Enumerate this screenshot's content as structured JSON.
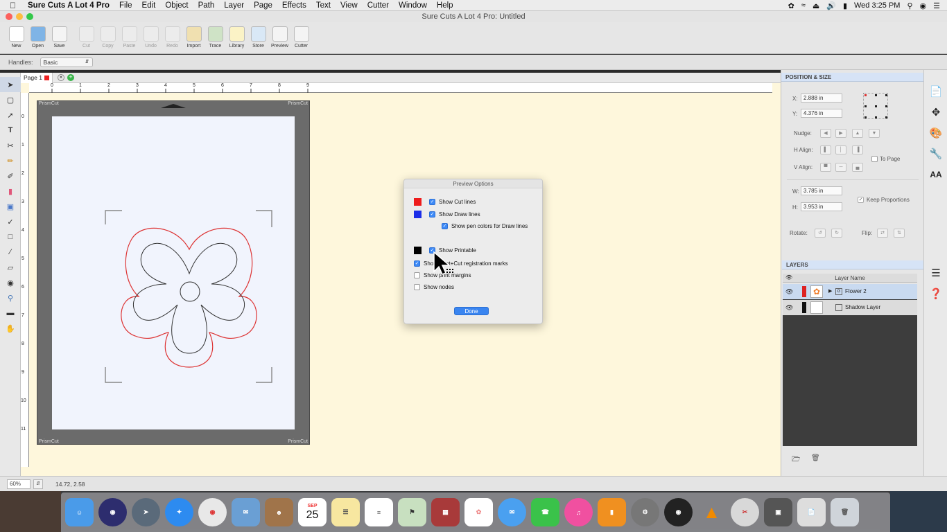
{
  "menubar": {
    "app_name": "Sure Cuts A Lot 4 Pro",
    "items": [
      "File",
      "Edit",
      "Object",
      "Path",
      "Layer",
      "Page",
      "Effects",
      "Text",
      "View",
      "Cutter",
      "Window",
      "Help"
    ],
    "clock": "Wed 3:25 PM"
  },
  "window": {
    "title": "Sure Cuts A Lot 4 Pro: Untitled"
  },
  "toolbar": {
    "buttons": [
      {
        "label": "New"
      },
      {
        "label": "Open"
      },
      {
        "label": "Save"
      },
      {
        "label": "Cut"
      },
      {
        "label": "Copy"
      },
      {
        "label": "Paste"
      },
      {
        "label": "Undo"
      },
      {
        "label": "Redo"
      },
      {
        "label": "Import"
      },
      {
        "label": "Trace"
      },
      {
        "label": "Library"
      },
      {
        "label": "Store"
      },
      {
        "label": "Preview"
      },
      {
        "label": "Cutter"
      }
    ]
  },
  "handles": {
    "label": "Handles:",
    "value": "Basic"
  },
  "page_tab": {
    "label": "Page 1"
  },
  "ruler": {
    "h_ticks": [
      "0",
      "1",
      "2",
      "3",
      "4",
      "5",
      "6",
      "7",
      "8",
      "9"
    ],
    "v_ticks": [
      "0",
      "1",
      "2",
      "3",
      "4",
      "5",
      "6",
      "7",
      "8",
      "9",
      "10",
      "11"
    ]
  },
  "mat": {
    "brand": "PrismCut"
  },
  "status": {
    "zoom": "60%",
    "coords": "14.72, 2.58"
  },
  "position_size": {
    "title": "POSITION & SIZE",
    "x_label": "X:",
    "x": "2.888 in",
    "y_label": "Y:",
    "y": "4.376 in",
    "nudge_label": "Nudge:",
    "halign_label": "H Align:",
    "valign_label": "V Align:",
    "to_page_label": "To Page",
    "w_label": "W:",
    "w": "3.785 in",
    "h_label": "H:",
    "h": "3.953 in",
    "keep_prop_label": "Keep Proportions",
    "rotate_label": "Rotate:",
    "flip_label": "Flip:"
  },
  "layers": {
    "title": "LAYERS",
    "col_header": "Layer Name",
    "rows": [
      {
        "name": "Flower 2"
      },
      {
        "name": "Shadow Layer"
      }
    ]
  },
  "dialog": {
    "title": "Preview Options",
    "show_cut": "Show Cut lines",
    "show_draw": "Show Draw lines",
    "show_pen": "Show pen colors for Draw lines",
    "show_printable": "Show Printable",
    "show_regmarks": "Show Print+Cut registration marks",
    "show_margins": "Show print margins",
    "show_nodes": "Show nodes",
    "done": "Done",
    "colors": {
      "cut": "#ee1c1c",
      "draw": "#1c2ee8",
      "printable": "#000000"
    }
  },
  "dock": {
    "calendar_month": "SEP",
    "calendar_day": "25"
  }
}
